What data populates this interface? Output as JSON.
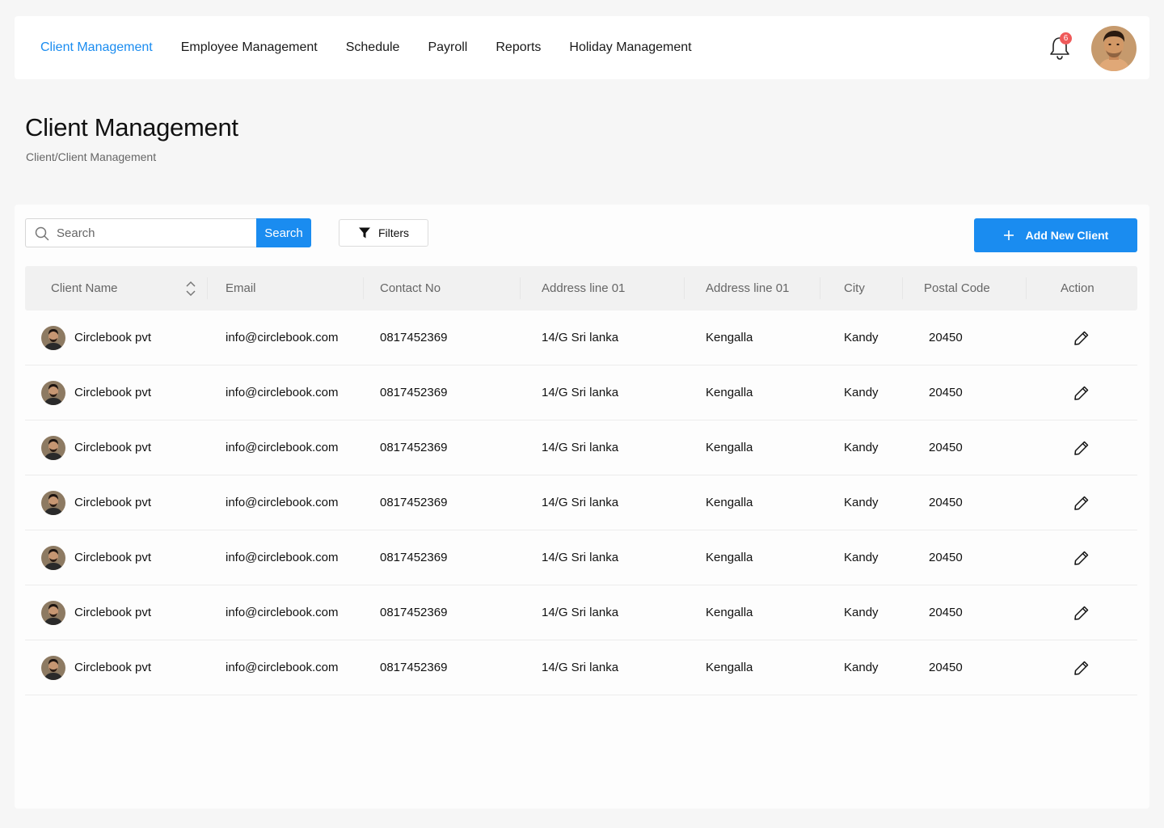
{
  "nav": {
    "items": [
      {
        "label": "Client Management",
        "active": true
      },
      {
        "label": "Employee Management",
        "active": false
      },
      {
        "label": "Schedule",
        "active": false
      },
      {
        "label": "Payroll",
        "active": false
      },
      {
        "label": "Reports",
        "active": false
      },
      {
        "label": "Holiday Management",
        "active": false
      }
    ],
    "notification_count": "6"
  },
  "page": {
    "title": "Client Management",
    "breadcrumb": "Client/Client Management"
  },
  "toolbar": {
    "search_placeholder": "Search",
    "search_button": "Search",
    "filters_button": "Filters",
    "add_button": "Add New Client"
  },
  "table": {
    "columns": [
      "Client Name",
      "Email",
      "Contact No",
      "Address line 01",
      "Address line 01",
      "City",
      "Postal Code",
      "Action"
    ],
    "rows": [
      {
        "name": "Circlebook pvt",
        "email": "info@circlebook.com",
        "contact": "0817452369",
        "address1": "14/G Sri lanka",
        "address2": "Kengalla",
        "city": "Kandy",
        "postal": "20450"
      },
      {
        "name": "Circlebook pvt",
        "email": "info@circlebook.com",
        "contact": "0817452369",
        "address1": "14/G Sri lanka",
        "address2": "Kengalla",
        "city": "Kandy",
        "postal": "20450"
      },
      {
        "name": "Circlebook pvt",
        "email": "info@circlebook.com",
        "contact": "0817452369",
        "address1": "14/G Sri lanka",
        "address2": "Kengalla",
        "city": "Kandy",
        "postal": "20450"
      },
      {
        "name": "Circlebook pvt",
        "email": "info@circlebook.com",
        "contact": "0817452369",
        "address1": "14/G Sri lanka",
        "address2": "Kengalla",
        "city": "Kandy",
        "postal": "20450"
      },
      {
        "name": "Circlebook pvt",
        "email": "info@circlebook.com",
        "contact": "0817452369",
        "address1": "14/G Sri lanka",
        "address2": "Kengalla",
        "city": "Kandy",
        "postal": "20450"
      },
      {
        "name": "Circlebook pvt",
        "email": "info@circlebook.com",
        "contact": "0817452369",
        "address1": "14/G Sri lanka",
        "address2": "Kengalla",
        "city": "Kandy",
        "postal": "20450"
      },
      {
        "name": "Circlebook pvt",
        "email": "info@circlebook.com",
        "contact": "0817452369",
        "address1": "14/G Sri lanka",
        "address2": "Kengalla",
        "city": "Kandy",
        "postal": "20450"
      }
    ]
  },
  "colors": {
    "accent": "#1a8cf0",
    "badge": "#ef5a5a"
  }
}
